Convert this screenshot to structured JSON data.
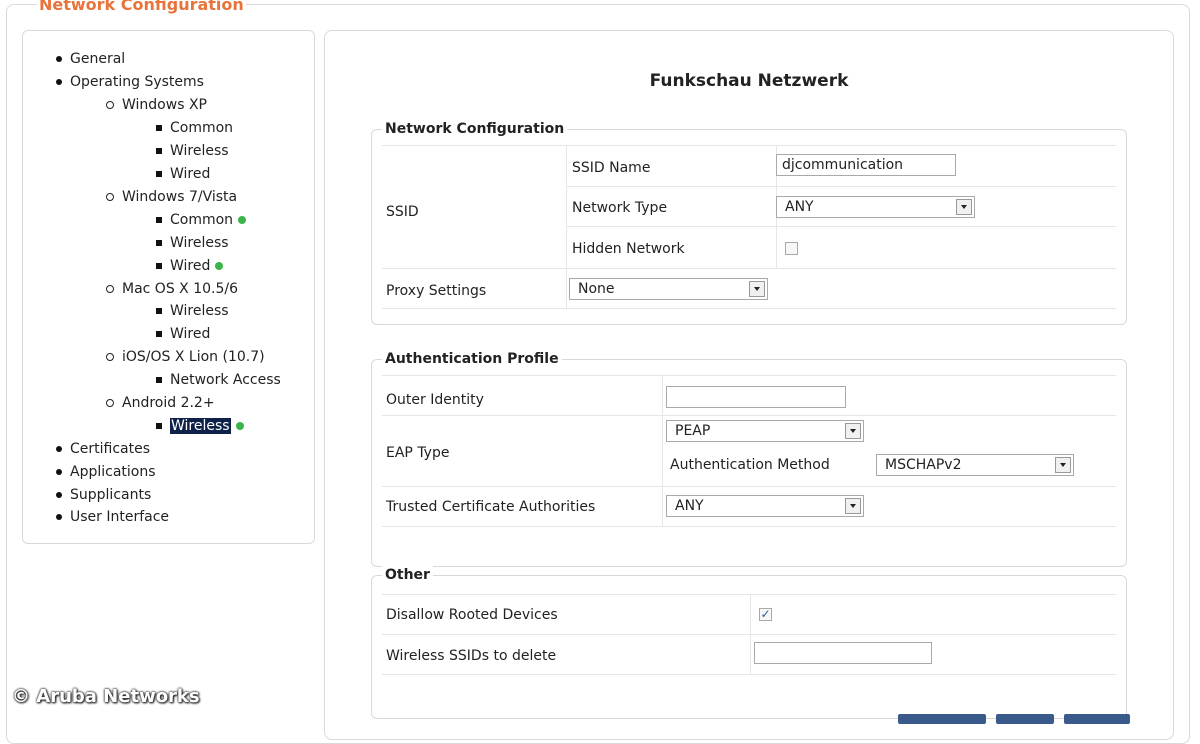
{
  "page": {
    "header": "Network Configuration",
    "watermark": "© Aruba Networks"
  },
  "tree": {
    "general": "General",
    "operating_systems": "Operating Systems",
    "winxp": "Windows XP",
    "winxp_common": "Common",
    "winxp_wireless": "Wireless",
    "winxp_wired": "Wired",
    "win7": "Windows 7/Vista",
    "win7_common": "Common",
    "win7_wireless": "Wireless",
    "win7_wired": "Wired",
    "mac": "Mac OS X 10.5/6",
    "mac_wireless": "Wireless",
    "mac_wired": "Wired",
    "ios": "iOS/OS X Lion (10.7)",
    "ios_network_access": "Network Access",
    "android": "Android 2.2+",
    "android_wireless": "Wireless",
    "certificates": "Certificates",
    "applications": "Applications",
    "supplicants": "Supplicants",
    "user_interface": "User Interface",
    "status_color": "#3bb54a",
    "selected_color": "#0e2149"
  },
  "main": {
    "title": "Funkschau Netzwerk",
    "network_configuration": {
      "legend": "Network Configuration",
      "ssid_label": "SSID",
      "ssid_name_label": "SSID Name",
      "ssid_name_value": "djcommunication",
      "network_type_label": "Network Type",
      "network_type_value": "ANY",
      "hidden_network_label": "Hidden Network",
      "proxy_label": "Proxy Settings",
      "proxy_value": "None"
    },
    "authentication_profile": {
      "legend": "Authentication Profile",
      "outer_identity_label": "Outer Identity",
      "outer_identity_value": "",
      "eap_type_label": "EAP Type",
      "eap_type_value": "PEAP",
      "auth_method_label": "Authentication Method",
      "auth_method_value": "MSCHAPv2",
      "trusted_ca_label": "Trusted Certificate Authorities",
      "trusted_ca_value": "ANY"
    },
    "other": {
      "legend": "Other",
      "disallow_rooted_label": "Disallow Rooted Devices",
      "disallow_rooted_checked": true,
      "check_mark": "✓",
      "ssids_delete_label": "Wireless SSIDs to delete",
      "ssids_delete_value": ""
    }
  },
  "colors": {
    "header": "#e8743b",
    "button": "#3a5a8c",
    "border": "#d9d9d9"
  }
}
